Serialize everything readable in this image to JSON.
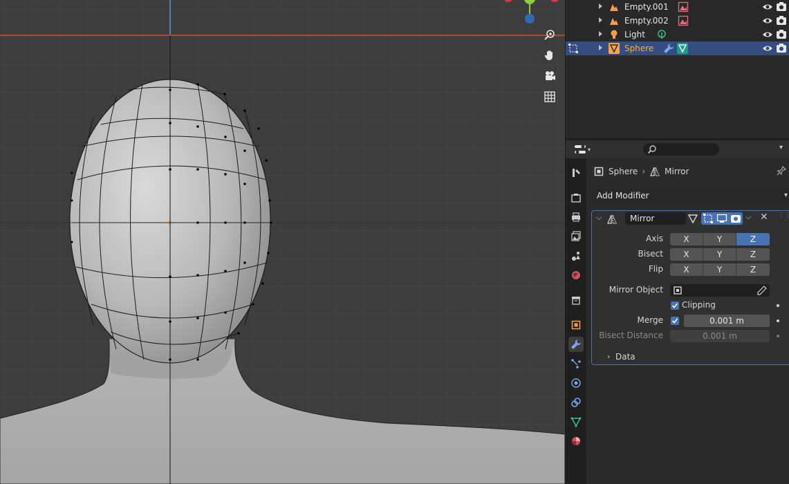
{
  "outliner": {
    "rows": [
      {
        "label": "Empty.001",
        "icon": "empty-object-icon",
        "data_icon": "image-data-icon"
      },
      {
        "label": "Empty.002",
        "icon": "empty-object-icon",
        "data_icon": "image-data-icon"
      },
      {
        "label": "Light",
        "icon": "light-object-icon",
        "data_icon": "light-data-icon"
      },
      {
        "label": "Sphere",
        "icon": "mesh-object-icon",
        "data_icon": "mesh-data-icon",
        "selected": true
      }
    ]
  },
  "properties": {
    "breadcrumb": {
      "object": "Sphere",
      "modifier": "Mirror"
    },
    "add_modifier": "Add Modifier",
    "modifier": {
      "name": "Mirror",
      "axis_label": "Axis",
      "bisect_label": "Bisect",
      "flip_label": "Flip",
      "axis": [
        "X",
        "Y",
        "Z"
      ],
      "axis_active": "Z",
      "bisect": [
        "X",
        "Y",
        "Z"
      ],
      "flip": [
        "X",
        "Y",
        "Z"
      ],
      "mirror_object_label": "Mirror Object",
      "clipping_label": "Clipping",
      "merge_label": "Merge",
      "merge_value": "0.001 m",
      "bisect_distance_label": "Bisect Distance",
      "bisect_distance_value": "0.001 m",
      "data_label": "Data"
    }
  },
  "colors": {
    "selection": "#334d80",
    "accent": "#4772b3",
    "active_object_text": "#ffaf29",
    "x_axis_line": "#c8572a"
  }
}
